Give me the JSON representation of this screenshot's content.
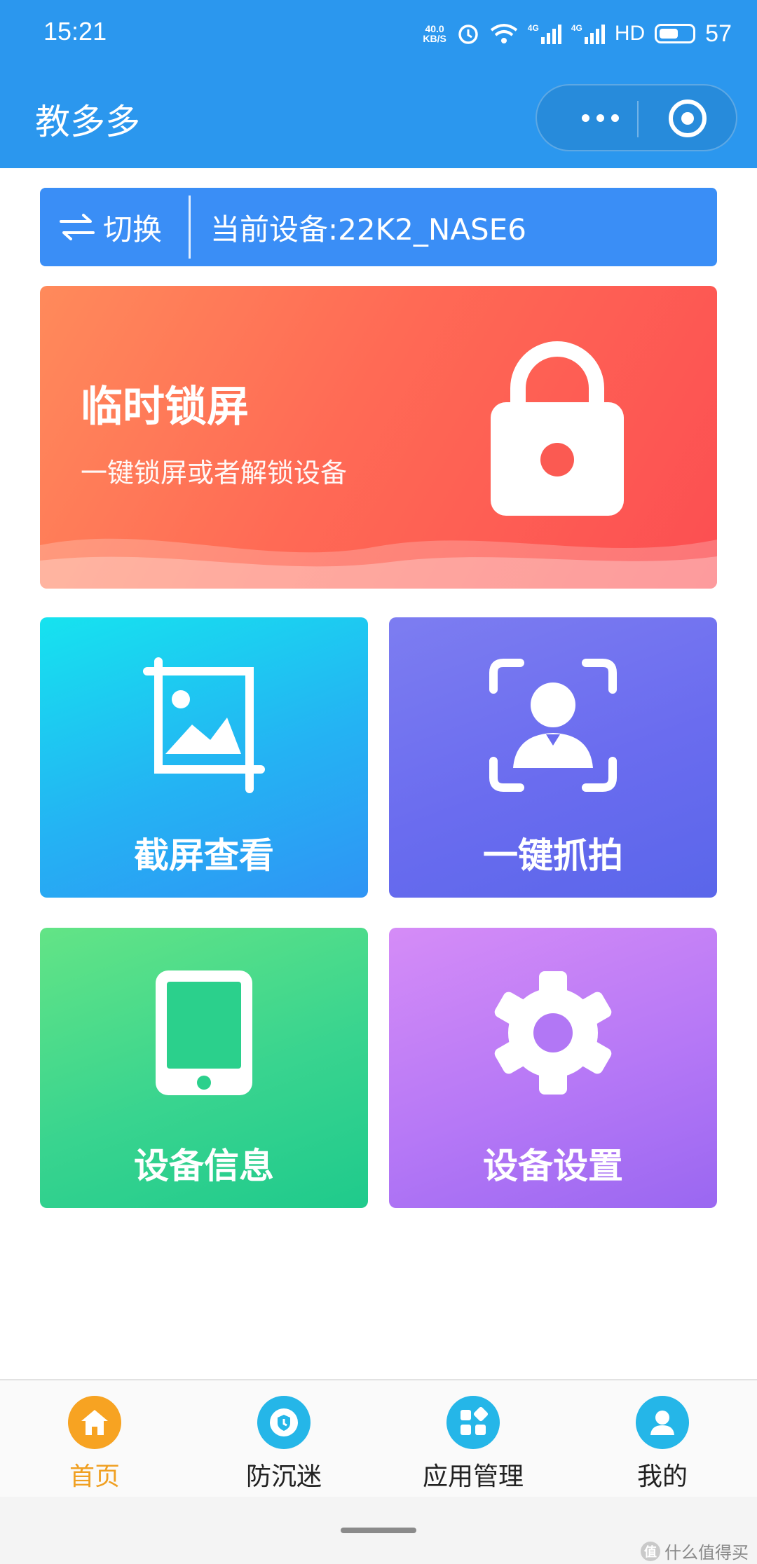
{
  "status_bar": {
    "time": "15:21",
    "net_speed_value": "40.0",
    "net_speed_unit": "KB/S",
    "sim1": "4G",
    "sim2": "4G",
    "hd": "HD",
    "battery": "57"
  },
  "header": {
    "title": "教多多"
  },
  "device_bar": {
    "switch_label": "切换",
    "current_device": "当前设备:22K2_NASE6"
  },
  "banner": {
    "title": "临时锁屏",
    "subtitle": "一键锁屏或者解锁设备"
  },
  "tiles": [
    {
      "label": "截屏查看",
      "icon": "image-crop-icon"
    },
    {
      "label": "一键抓拍",
      "icon": "face-capture-icon"
    },
    {
      "label": "设备信息",
      "icon": "tablet-icon"
    },
    {
      "label": "设备设置",
      "icon": "gear-icon"
    }
  ],
  "tabbar": {
    "items": [
      {
        "label": "首页",
        "icon": "home-icon",
        "active": true
      },
      {
        "label": "防沉迷",
        "icon": "clock-shield-icon",
        "active": false
      },
      {
        "label": "应用管理",
        "icon": "apps-grid-icon",
        "active": false
      },
      {
        "label": "我的",
        "icon": "user-icon",
        "active": false
      }
    ]
  },
  "watermark": {
    "badge": "值",
    "text": "什么值得买"
  },
  "colors": {
    "primary": "#2b97ee",
    "device_bar": "#3a8ef6",
    "active_tab": "#f0a022"
  }
}
